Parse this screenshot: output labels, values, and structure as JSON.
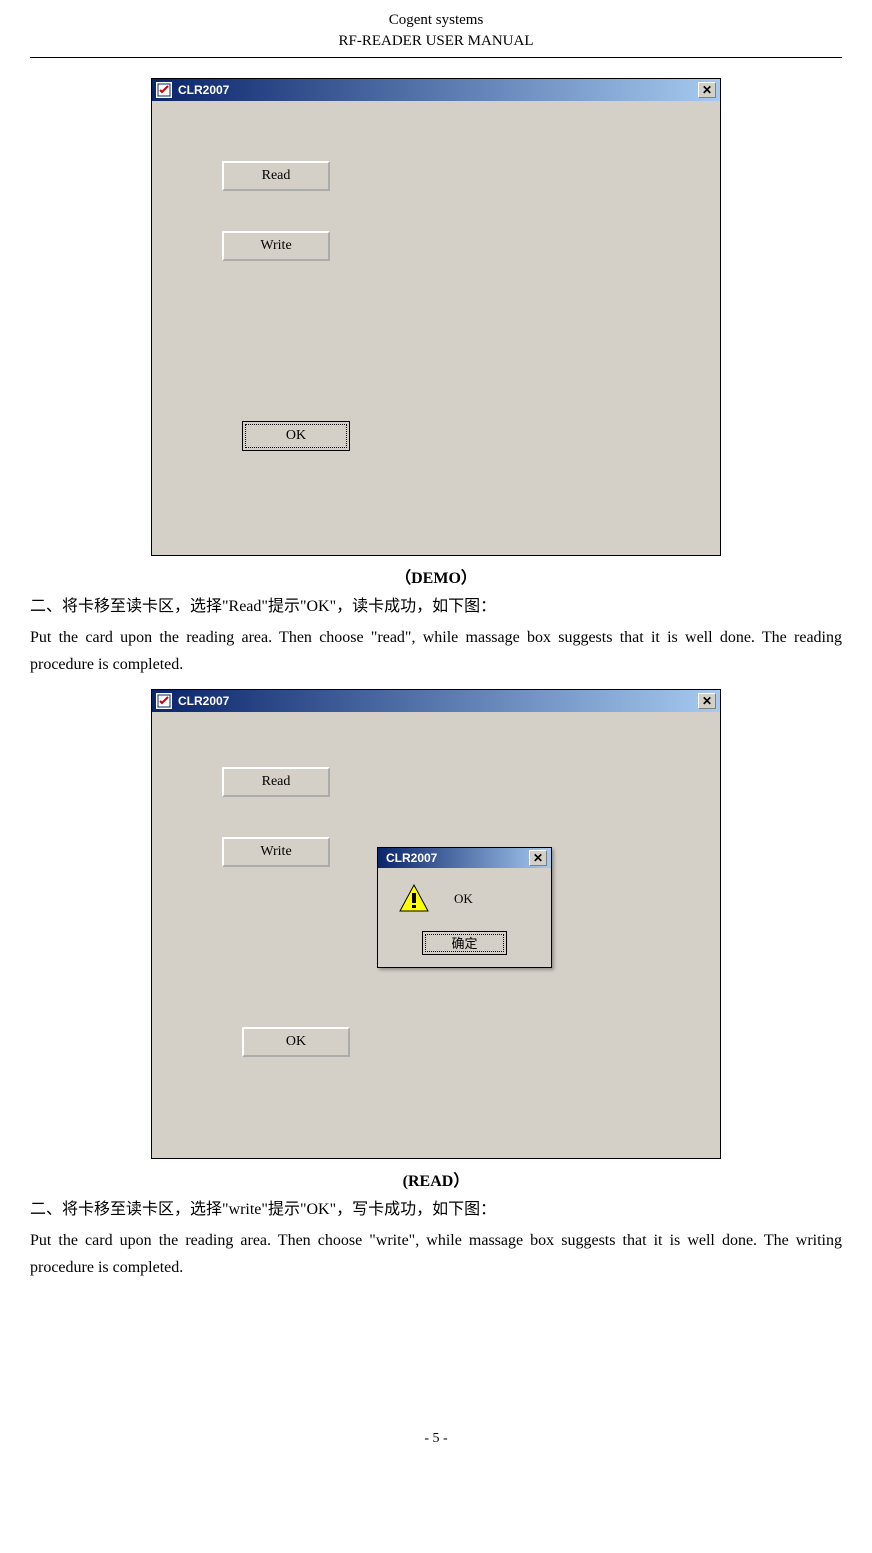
{
  "header": {
    "line1": "Cogent systems",
    "line2": "RF-READER USER MANUAL"
  },
  "screenshot1": {
    "title": "CLR2007",
    "read_button": "Read",
    "write_button": "Write",
    "ok_button": "OK"
  },
  "caption1": "（DEMO）",
  "para1_cn": "二、将卡移至读卡区，选择\"Read\"提示\"OK\"，读卡成功，如下图：",
  "para1_en": "Put the card upon the reading area. Then choose \"read\", while massage box suggests that it is well done. The reading procedure is completed.",
  "screenshot2": {
    "title": "CLR2007",
    "read_button": "Read",
    "write_button": "Write",
    "ok_button": "OK",
    "dialog_title": "CLR2007",
    "dialog_msg": "OK",
    "dialog_confirm": "确定"
  },
  "caption2": "(READ）",
  "para2_cn": "二、将卡移至读卡区，选择\"write\"提示\"OK\"，写卡成功，如下图：",
  "para2_en": "Put the card upon the reading area. Then choose \"write\", while massage box suggests that it is well done. The writing procedure is completed.",
  "footer": "- 5 -"
}
